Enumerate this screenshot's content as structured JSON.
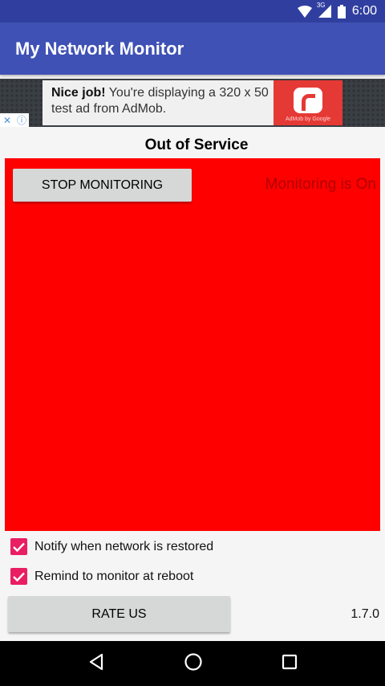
{
  "status_bar": {
    "time": "6:00",
    "network": "3G"
  },
  "app_bar": {
    "title": "My Network Monitor"
  },
  "ad": {
    "headline": "Nice job!",
    "body": " You're displaying a 320 x 50 test ad from AdMob.",
    "brand": "AdMob by Google"
  },
  "main": {
    "status_title": "Out of Service",
    "stop_button": "Stop Monitoring",
    "monitoring_label": "Monitoring is On",
    "status_color": "#ff0000"
  },
  "options": {
    "notify_label": "Notify when network is restored",
    "notify_checked": true,
    "remind_label": "Remind to monitor at reboot",
    "remind_checked": true
  },
  "footer": {
    "rate_button": "Rate Us",
    "version": "1.7.0"
  },
  "colors": {
    "primary": "#3f51b5",
    "primary_dark": "#303f9f",
    "accent": "#e91e63"
  }
}
